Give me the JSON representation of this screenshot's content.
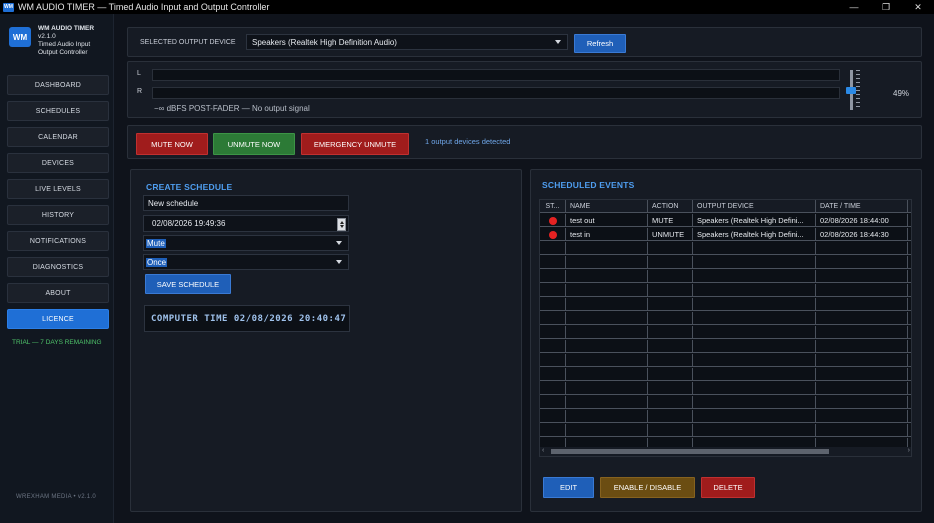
{
  "window": {
    "app_icon": "WM",
    "title": "WM AUDIO TIMER — Timed Audio Input and Output Controller",
    "minimize_glyph": "—",
    "restore_glyph": "❐",
    "close_glyph": "✕"
  },
  "sidebar": {
    "logo": "WM",
    "brand_name": "WM AUDIO TIMER",
    "version": "v2.1.0",
    "tagline_1": "Timed Audio Input",
    "tagline_2": "Output Controller",
    "items": [
      {
        "label": "DASHBOARD"
      },
      {
        "label": "SCHEDULES"
      },
      {
        "label": "CALENDAR"
      },
      {
        "label": "DEVICES"
      },
      {
        "label": "LIVE LEVELS"
      },
      {
        "label": "HISTORY"
      },
      {
        "label": "NOTIFICATIONS"
      },
      {
        "label": "DIAGNOSTICS"
      },
      {
        "label": "ABOUT"
      },
      {
        "label": "LICENCE",
        "active": true
      }
    ],
    "trial": "TRIAL — 7 DAYS REMAINING",
    "footer": "WREXHAM MEDIA  •  v2.1.0"
  },
  "output": {
    "label": "SELECTED OUTPUT DEVICE",
    "device": "Speakers (Realtek High Definition Audio)",
    "refresh": "Refresh"
  },
  "levels": {
    "left_label": "L",
    "right_label": "R",
    "readout": "−∞ dBFS POST-FADER — No output signal",
    "volume_pct": "49%",
    "volume_value": 0.49
  },
  "actions": {
    "mute": "MUTE NOW",
    "unmute": "UNMUTE NOW",
    "emergency": "EMERGENCY UNMUTE",
    "status": "1 output devices detected"
  },
  "create": {
    "title": "CREATE SCHEDULE",
    "name": "New schedule",
    "datetime": "02/08/2026 19:49:36",
    "action": "Mute",
    "repeat": "Once",
    "save": "SAVE SCHEDULE",
    "clock": "COMPUTER TIME  02/08/2026  20:40:47"
  },
  "events": {
    "title": "SCHEDULED EVENTS",
    "columns": [
      "ST...",
      "NAME",
      "ACTION",
      "OUTPUT DEVICE",
      "DATE / TIME",
      "I"
    ],
    "rows": [
      {
        "name": "test out",
        "action": "MUTE",
        "device": "Speakers (Realtek High Defini...",
        "datetime": "02/08/2026 18:44:00",
        "extra": "("
      },
      {
        "name": "test in",
        "action": "UNMUTE",
        "device": "Speakers (Realtek High Defini...",
        "datetime": "02/08/2026 18:44:30",
        "extra": "("
      }
    ],
    "scroll_left": "‹",
    "scroll_right": "›",
    "edit": "EDIT",
    "toggle": "ENABLE / DISABLE",
    "delete": "DELETE"
  },
  "colors": {
    "accent": "#1f6fd6",
    "danger": "#a01c1c",
    "success": "#2c7a36",
    "warning": "#6b4d12",
    "status_dot": "#e52222"
  }
}
